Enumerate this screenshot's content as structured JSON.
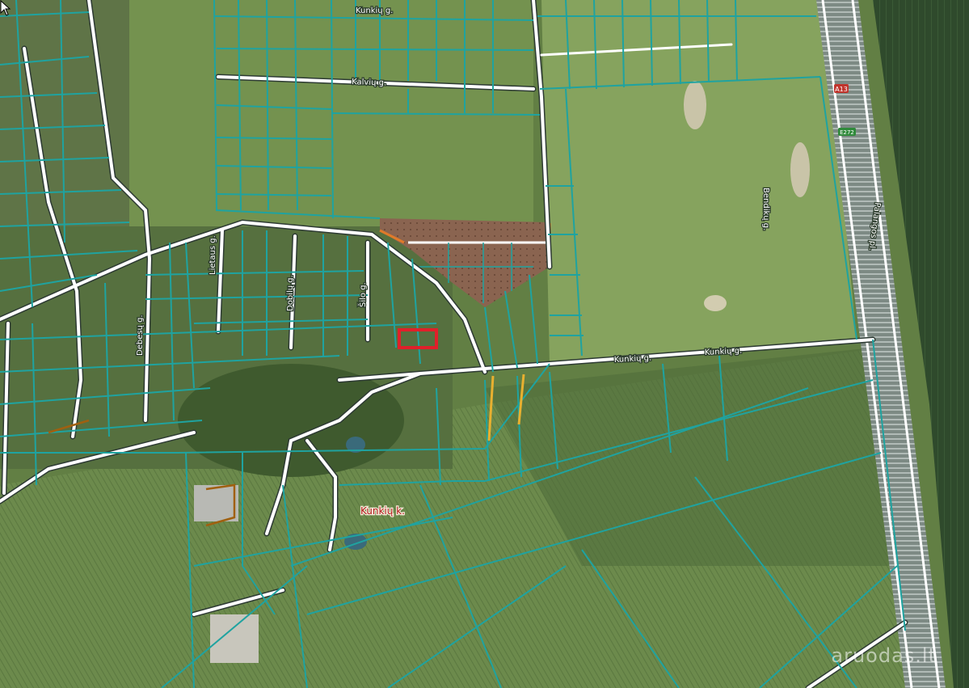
{
  "map": {
    "streets": [
      {
        "name": "Kunkių g."
      },
      {
        "name": "Kalvių g."
      },
      {
        "name": "Kunkių g."
      },
      {
        "name": "Kunkių g."
      },
      {
        "name": "Bendikų g."
      },
      {
        "name": "Palangos pl."
      },
      {
        "name": "Lietaus g."
      },
      {
        "name": "Debesų g."
      },
      {
        "name": "Dobilų g."
      },
      {
        "name": "Šilo g."
      }
    ],
    "village_label": "Kunkių k.",
    "road_shield": "A13",
    "road_shield_2": "E272",
    "watermark": "aruodas.lt",
    "selected_parcel_color": "#e0202a",
    "parcel_line_color": "#1fa3a0",
    "road_color": "#ffffff",
    "subdivided_area_color": "#9a6a55"
  }
}
